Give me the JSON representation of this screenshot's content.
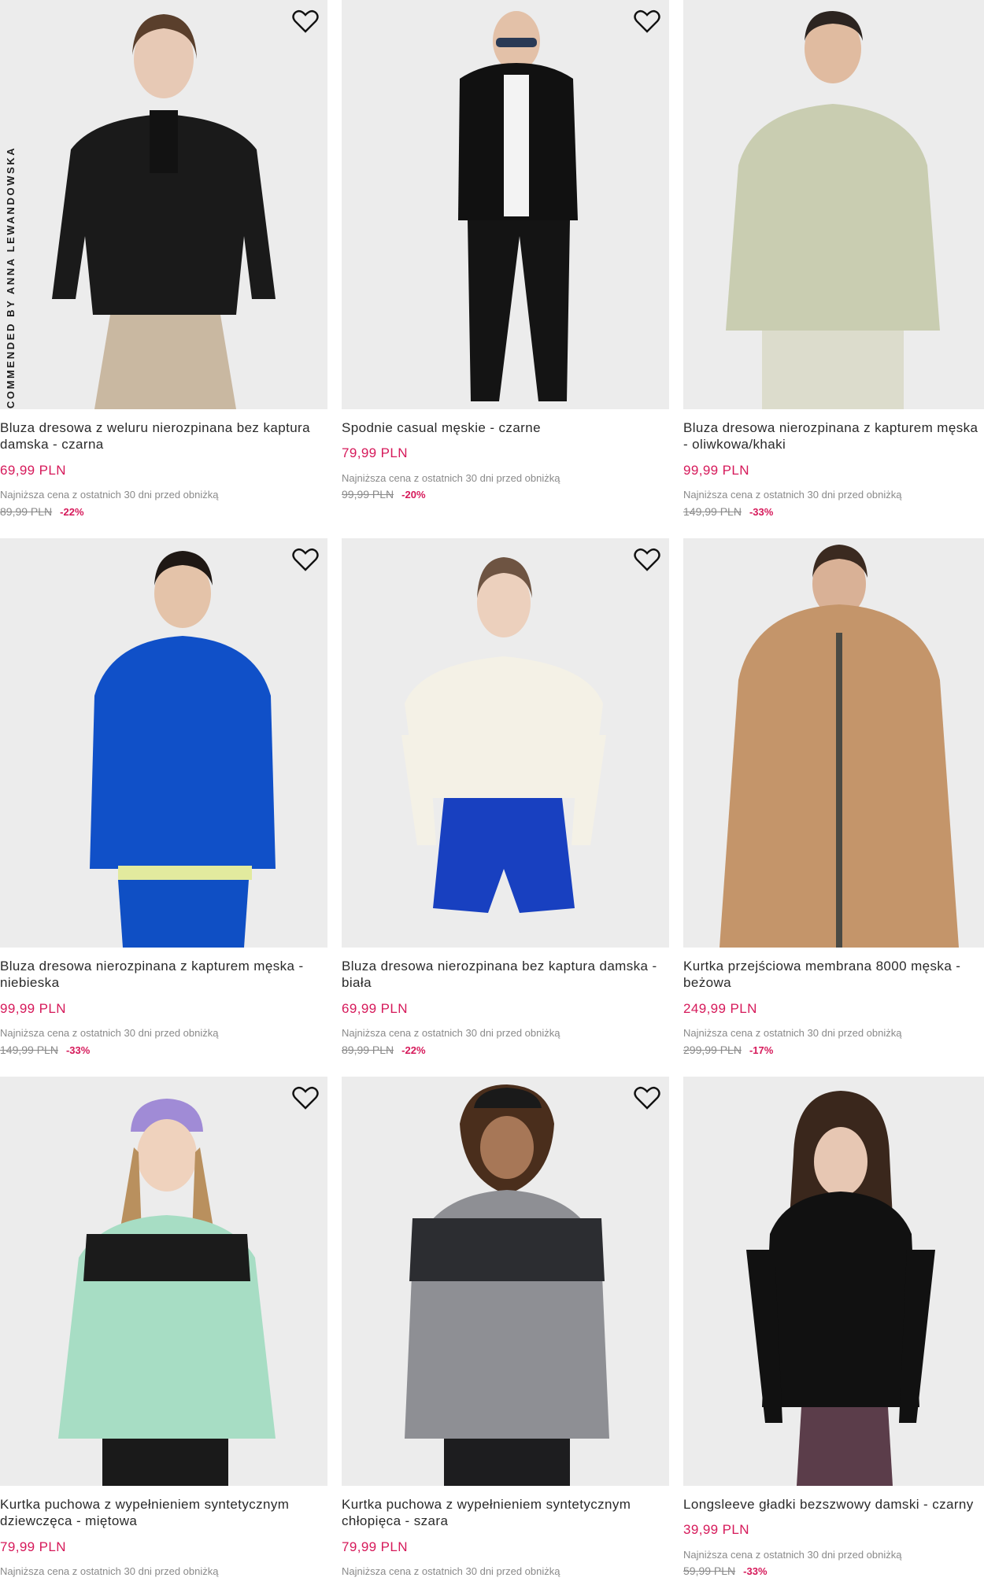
{
  "recommended_badge": "RECOMMENDED BY ANNA LEWANDOWSKA",
  "colors": {
    "accent_price": "#d6195a",
    "muted_text": "#8a8a8a",
    "photo_background": "#ebecec"
  },
  "wishlist_icon": "heart-outline-icon",
  "lowest_label": "Najniższa cena z ostatnich 30 dni przed obniżką",
  "products": [
    {
      "title": "Bluza dresowa z weluru nierozpinana bez kaptura damska - czarna",
      "price": "69,99 PLN",
      "lowest": "Najniższa cena z ostatnich 30 dni przed obniżką",
      "old_price": "89,99 PLN",
      "discount": "-22%"
    },
    {
      "title": "Spodnie casual męskie - czarne",
      "price": "79,99 PLN",
      "lowest": "Najniższa cena z ostatnich 30 dni przed obniżką",
      "old_price": "99,99 PLN",
      "discount": "-20%"
    },
    {
      "title": "Bluza dresowa nierozpinana z kapturem męska - oliwkowa/khaki",
      "price": "99,99 PLN",
      "lowest": "Najniższa cena z ostatnich 30 dni przed obniżką",
      "old_price": "149,99 PLN",
      "discount": "-33%"
    },
    {
      "title": "Bluza dresowa nierozpinana z kapturem męska - niebieska",
      "price": "99,99 PLN",
      "lowest": "Najniższa cena z ostatnich 30 dni przed obniżką",
      "old_price": "149,99 PLN",
      "discount": "-33%"
    },
    {
      "title": "Bluza dresowa nierozpinana bez kaptura damska - biała",
      "price": "69,99 PLN",
      "lowest": "Najniższa cena z ostatnich 30 dni przed obniżką",
      "old_price": "89,99 PLN",
      "discount": "-22%"
    },
    {
      "title": "Kurtka przejściowa membrana 8000 męska - beżowa",
      "price": "249,99 PLN",
      "lowest": "Najniższa cena z ostatnich 30 dni przed obniżką",
      "old_price": "299,99 PLN",
      "discount": "-17%"
    },
    {
      "title": "Kurtka puchowa z wypełnieniem syntetycznym dziewczęca - miętowa",
      "price": "79,99 PLN",
      "lowest": "Najniższa cena z ostatnich 30 dni przed obniżką",
      "old_price": "",
      "discount": ""
    },
    {
      "title": "Kurtka puchowa z wypełnieniem syntetycznym chłopięca - szara",
      "price": "79,99 PLN",
      "lowest": "Najniższa cena z ostatnich 30 dni przed obniżką",
      "old_price": "",
      "discount": ""
    },
    {
      "title": "Longsleeve gładki bezszwowy damski - czarny",
      "price": "39,99 PLN",
      "lowest": "Najniższa cena z ostatnich 30 dni przed obniżką",
      "old_price": "59,99 PLN",
      "discount": "-33%"
    }
  ]
}
